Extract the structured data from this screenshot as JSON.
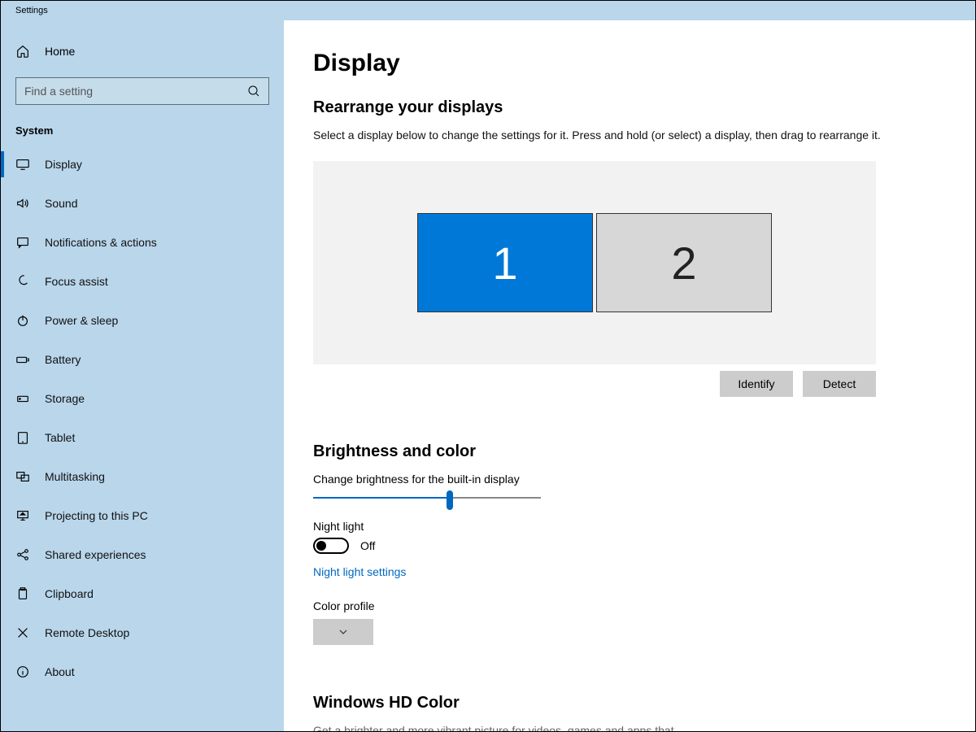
{
  "window": {
    "title": "Settings"
  },
  "sidebar": {
    "home": "Home",
    "search_placeholder": "Find a setting",
    "section": "System",
    "items": [
      {
        "label": "Display"
      },
      {
        "label": "Sound"
      },
      {
        "label": "Notifications & actions"
      },
      {
        "label": "Focus assist"
      },
      {
        "label": "Power & sleep"
      },
      {
        "label": "Battery"
      },
      {
        "label": "Storage"
      },
      {
        "label": "Tablet"
      },
      {
        "label": "Multitasking"
      },
      {
        "label": "Projecting to this PC"
      },
      {
        "label": "Shared experiences"
      },
      {
        "label": "Clipboard"
      },
      {
        "label": "Remote Desktop"
      },
      {
        "label": "About"
      }
    ],
    "active_index": 0
  },
  "main": {
    "title": "Display",
    "rearrange": {
      "heading": "Rearrange your displays",
      "desc": "Select a display below to change the settings for it. Press and hold (or select) a display, then drag to rearrange it.",
      "monitors": [
        {
          "id": "1",
          "primary": true
        },
        {
          "id": "2",
          "primary": false
        }
      ],
      "identify": "Identify",
      "detect": "Detect"
    },
    "brightness": {
      "heading": "Brightness and color",
      "slider_label": "Change brightness for the built-in display",
      "slider_value": 60,
      "nightlight_label": "Night light",
      "nightlight_state": "Off",
      "nightlight_link": "Night light settings",
      "colorprofile_label": "Color profile"
    },
    "hdcolor": {
      "heading": "Windows HD Color",
      "desc": "Get a brighter and more vibrant picture for videos, games and apps that"
    }
  },
  "colors": {
    "accent": "#0067c0",
    "sidebar_bg": "#b9d6eb",
    "monitor_primary": "#0078d7"
  }
}
